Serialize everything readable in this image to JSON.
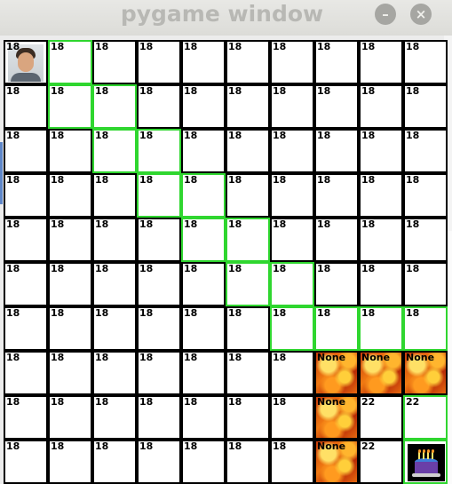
{
  "window": {
    "title": "pygame window",
    "minimize_glyph": "–",
    "close_glyph": "×"
  },
  "grid": {
    "rows": [
      [
        "18",
        "18",
        "18",
        "18",
        "18",
        "18",
        "18",
        "18",
        "18",
        "18"
      ],
      [
        "18",
        "18",
        "18",
        "18",
        "18",
        "18",
        "18",
        "18",
        "18",
        "18"
      ],
      [
        "18",
        "18",
        "18",
        "18",
        "18",
        "18",
        "18",
        "18",
        "18",
        "18"
      ],
      [
        "18",
        "18",
        "18",
        "18",
        "18",
        "18",
        "18",
        "18",
        "18",
        "18"
      ],
      [
        "18",
        "18",
        "18",
        "18",
        "18",
        "18",
        "18",
        "18",
        "18",
        "18"
      ],
      [
        "18",
        "18",
        "18",
        "18",
        "18",
        "18",
        "18",
        "18",
        "18",
        "18"
      ],
      [
        "18",
        "18",
        "18",
        "18",
        "18",
        "18",
        "18",
        "18",
        "18",
        "18"
      ],
      [
        "18",
        "18",
        "18",
        "18",
        "18",
        "18",
        "18",
        "None",
        "None",
        "None"
      ],
      [
        "18",
        "18",
        "18",
        "18",
        "18",
        "18",
        "18",
        "None",
        "22",
        "22"
      ],
      [
        "18",
        "18",
        "18",
        "18",
        "18",
        "18",
        "18",
        "None",
        "22",
        ""
      ]
    ],
    "path_cells": [
      [
        0,
        1
      ],
      [
        1,
        1
      ],
      [
        1,
        2
      ],
      [
        2,
        2
      ],
      [
        2,
        3
      ],
      [
        3,
        3
      ],
      [
        3,
        4
      ],
      [
        4,
        4
      ],
      [
        4,
        5
      ],
      [
        5,
        5
      ],
      [
        5,
        6
      ],
      [
        6,
        6
      ],
      [
        6,
        7
      ],
      [
        6,
        8
      ],
      [
        6,
        9
      ],
      [
        8,
        9
      ],
      [
        9,
        9
      ]
    ],
    "fire_cells": [
      [
        7,
        7
      ],
      [
        7,
        8
      ],
      [
        7,
        9
      ],
      [
        8,
        7
      ],
      [
        9,
        7
      ]
    ],
    "player_cell": [
      0,
      0
    ],
    "goal_cell": [
      9,
      9
    ],
    "player_sprite": "player-avatar",
    "goal_sprite": "birthday-cake",
    "fire_sprite": "fire-tile",
    "path_color": "#2fd62f"
  }
}
